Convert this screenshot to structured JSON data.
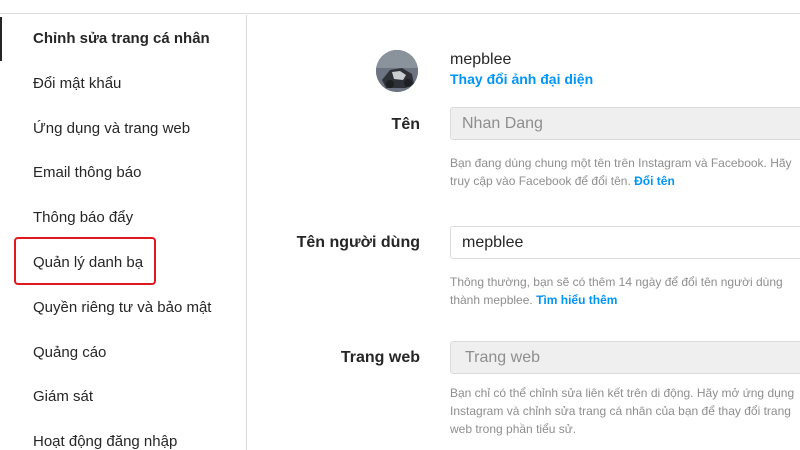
{
  "sidebar": {
    "items": [
      {
        "label": "Chỉnh sửa trang cá nhân"
      },
      {
        "label": "Đổi mật khẩu"
      },
      {
        "label": "Ứng dụng và trang web"
      },
      {
        "label": "Email thông báo"
      },
      {
        "label": "Thông báo đẩy"
      },
      {
        "label": "Quản lý danh bạ"
      },
      {
        "label": "Quyền riêng tư và bảo mật"
      },
      {
        "label": "Quảng cáo"
      },
      {
        "label": "Giám sát"
      },
      {
        "label": "Hoạt động đăng nhập"
      }
    ]
  },
  "profile": {
    "username": "mepblee",
    "change_photo": "Thay đổi ảnh đại diện"
  },
  "fields": {
    "name": {
      "label": "Tên",
      "value": "Nhan Dang",
      "help_line1": "Bạn đang dùng chung một tên trên Instagram và Facebook. Hãy",
      "help_line2": "truy cập vào Facebook để đổi tên.",
      "help_link": "Đổi tên"
    },
    "username": {
      "label": "Tên người dùng",
      "value": "mepblee",
      "help_line1": "Thông thường, bạn sẽ có thêm 14 ngày để đổi tên người dùng",
      "help_line2": "thành mepblee.",
      "help_link": "Tìm hiểu thêm"
    },
    "website": {
      "label": "Trang web",
      "placeholder": "Trang web",
      "help_line1": "Bạn chỉ có thể chỉnh sửa liên kết trên di động. Hãy mở ứng dụng",
      "help_line2": "Instagram và chỉnh sửa trang cá nhân của bạn để thay đổi trang",
      "help_line3": "web trong phần tiểu sử."
    }
  },
  "colors": {
    "link": "#0095f6",
    "highlight": "#e0191f",
    "border": "#dbdbdb"
  }
}
